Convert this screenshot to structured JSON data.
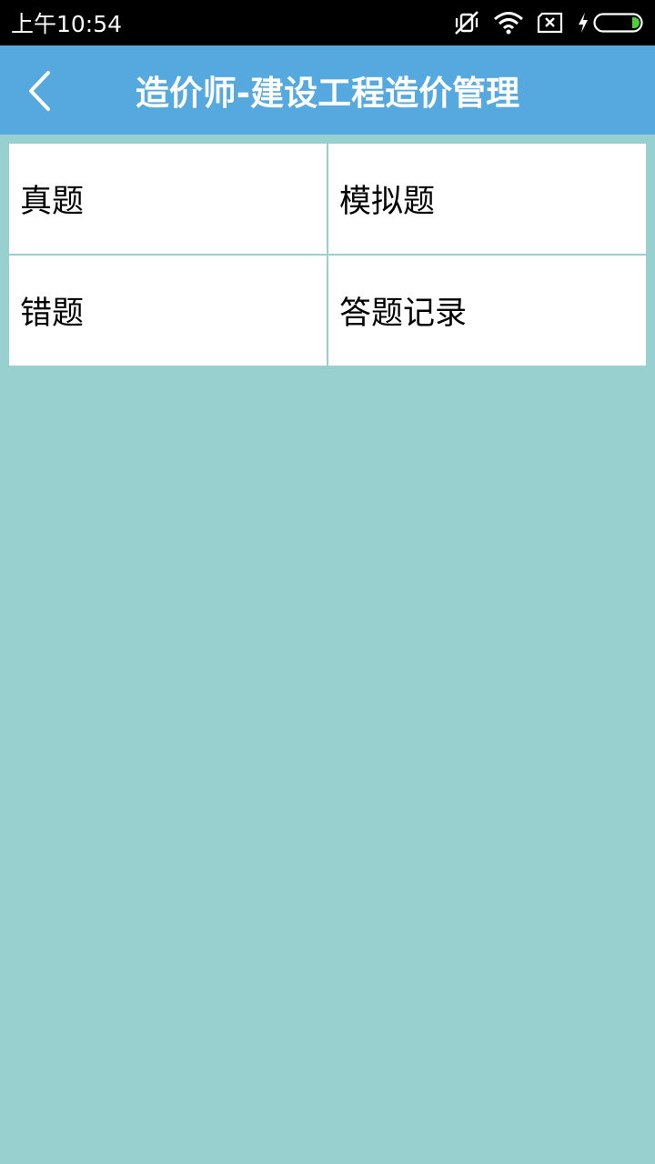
{
  "status_bar": {
    "time": "上午10:54",
    "icons": [
      "vibrate-off-icon",
      "wifi-icon",
      "no-sim-icon",
      "charging-icon",
      "battery-icon"
    ],
    "battery_level": 0.1
  },
  "header": {
    "title": "造价师-建设工程造价管理",
    "back_icon": "chevron-left-icon"
  },
  "menu": {
    "items": [
      {
        "label": "真题"
      },
      {
        "label": "模拟题"
      },
      {
        "label": "错题"
      },
      {
        "label": "答题记录"
      }
    ]
  },
  "colors": {
    "accent": "#55a9de",
    "page_bg": "#98cfcf",
    "status_bar_bg": "#000000",
    "battery_fill": "#4cd137"
  }
}
